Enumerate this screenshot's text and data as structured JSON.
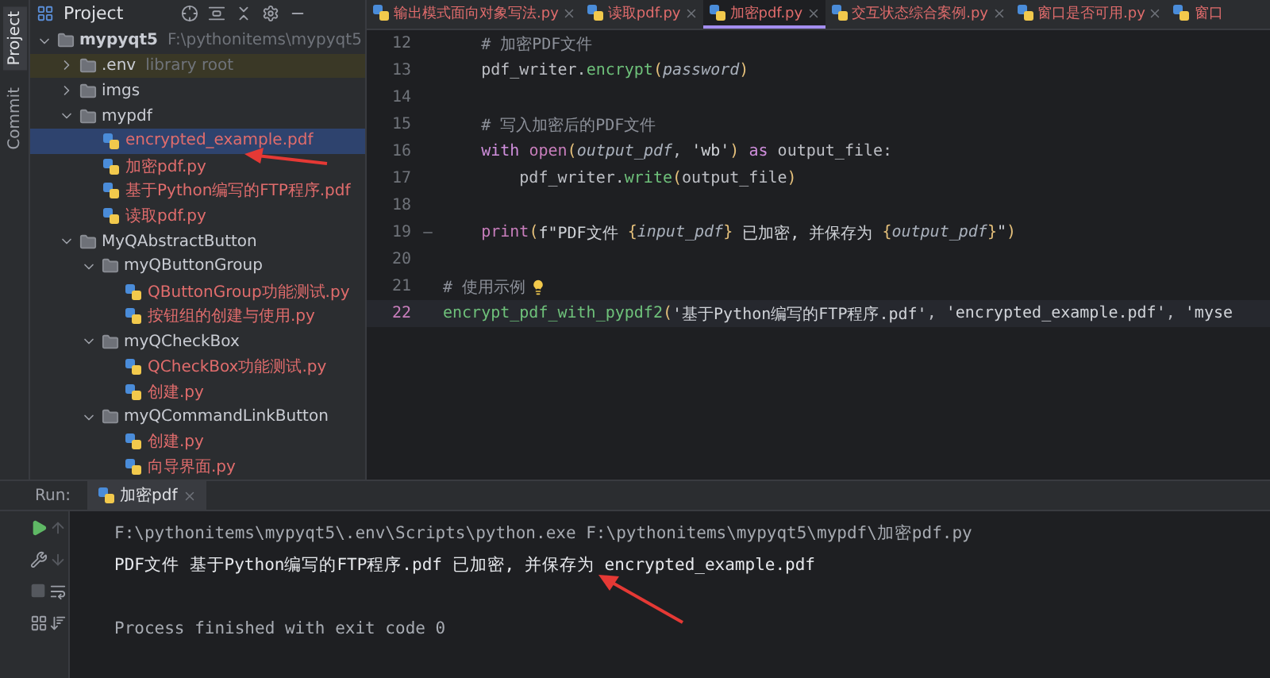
{
  "side_strip": {
    "tabs": [
      {
        "label": "Project",
        "selected": true
      },
      {
        "label": "Commit",
        "selected": false
      }
    ]
  },
  "project_panel": {
    "title": "Project",
    "tree": [
      {
        "kind": "folder",
        "name": "mypyqt5",
        "hint": "F:\\pythonitems\\mypyqt5",
        "expanded": true,
        "selected": false,
        "children": [
          {
            "kind": "library",
            "name": ".env",
            "hint": "library root",
            "expanded": false,
            "selected": false
          },
          {
            "kind": "folder",
            "name": "imgs",
            "expanded": false,
            "selected": false
          },
          {
            "kind": "folder",
            "name": "mypdf",
            "expanded": true,
            "selected": false,
            "children": [
              {
                "kind": "file",
                "name": "encrypted_example.pdf",
                "selected": true
              },
              {
                "kind": "file",
                "name": "加密pdf.py",
                "selected": false
              },
              {
                "kind": "file",
                "name": "基于Python编写的FTP程序.pdf",
                "selected": false
              },
              {
                "kind": "file",
                "name": "读取pdf.py",
                "selected": false
              }
            ]
          },
          {
            "kind": "folder",
            "name": "MyQAbstractButton",
            "expanded": true,
            "selected": false,
            "children": [
              {
                "kind": "folder",
                "name": "myQButtonGroup",
                "expanded": true,
                "selected": false,
                "children": [
                  {
                    "kind": "file",
                    "name": "QButtonGroup功能测试.py",
                    "selected": false
                  },
                  {
                    "kind": "file",
                    "name": "按钮组的创建与使用.py",
                    "selected": false
                  }
                ]
              },
              {
                "kind": "folder",
                "name": "myQCheckBox",
                "expanded": true,
                "selected": false,
                "children": [
                  {
                    "kind": "file",
                    "name": "QCheckBox功能测试.py",
                    "selected": false
                  },
                  {
                    "kind": "file",
                    "name": "创建.py",
                    "selected": false
                  }
                ]
              },
              {
                "kind": "folder",
                "name": "myQCommandLinkButton",
                "expanded": true,
                "selected": false,
                "children": [
                  {
                    "kind": "file",
                    "name": "创建.py",
                    "selected": false
                  },
                  {
                    "kind": "file",
                    "name": "向导界面.py",
                    "selected": false
                  }
                ]
              }
            ]
          }
        ]
      }
    ]
  },
  "editor": {
    "tabs": [
      {
        "label": "输出模式面向对象写法.py",
        "selected": false
      },
      {
        "label": "读取pdf.py",
        "selected": false
      },
      {
        "label": "加密pdf.py",
        "selected": true
      },
      {
        "label": "交互状态综合案例.py",
        "selected": false
      },
      {
        "label": "窗口是否可用.py",
        "selected": false
      },
      {
        "label": "窗口",
        "selected": false
      }
    ],
    "lines": [
      {
        "number": "12",
        "kind": "code",
        "current": false,
        "segments": [
          {
            "kind": "comment",
            "text": "    # 加密PDF文件"
          }
        ]
      },
      {
        "number": "13",
        "kind": "code",
        "current": false,
        "segments": [
          {
            "kind": "plain",
            "text": "    pdf_writer."
          },
          {
            "kind": "fn",
            "text": "encrypt"
          },
          {
            "kind": "paren",
            "text": "("
          },
          {
            "kind": "param",
            "text": "password"
          },
          {
            "kind": "paren",
            "text": ")"
          }
        ]
      },
      {
        "number": "14",
        "kind": "code",
        "current": false
      },
      {
        "number": "15",
        "kind": "code",
        "current": false,
        "segments": [
          {
            "kind": "comment",
            "text": "    # 写入加密后的PDF文件"
          }
        ]
      },
      {
        "number": "16",
        "kind": "code",
        "current": false,
        "segments": [
          {
            "kind": "kw",
            "text": "    with "
          },
          {
            "kind": "builtin",
            "text": "open"
          },
          {
            "kind": "paren",
            "text": "("
          },
          {
            "kind": "param",
            "text": "output_pdf"
          },
          {
            "kind": "plain",
            "text": ", "
          },
          {
            "kind": "string",
            "text": "'wb'"
          },
          {
            "kind": "paren",
            "text": ")"
          },
          {
            "kind": "kw",
            "text": " as "
          },
          {
            "kind": "plain",
            "text": "output_file:"
          }
        ]
      },
      {
        "number": "17",
        "kind": "code",
        "current": false,
        "segments": [
          {
            "kind": "plain",
            "text": "        pdf_writer."
          },
          {
            "kind": "fn",
            "text": "write"
          },
          {
            "kind": "paren",
            "text": "("
          },
          {
            "kind": "plain",
            "text": "output_file"
          },
          {
            "kind": "paren",
            "text": ")"
          }
        ]
      },
      {
        "number": "18",
        "kind": "code",
        "current": false
      },
      {
        "number": "19",
        "kind": "fold",
        "current": false,
        "segments": [
          {
            "kind": "builtin",
            "text": "    print"
          },
          {
            "kind": "paren",
            "text": "("
          },
          {
            "kind": "string",
            "text": "f\"PDF文件 "
          },
          {
            "kind": "brace",
            "text": "{"
          },
          {
            "kind": "param",
            "text": "input_pdf"
          },
          {
            "kind": "brace",
            "text": "}"
          },
          {
            "kind": "string",
            "text": " 已加密, 并保存为 "
          },
          {
            "kind": "brace",
            "text": "{"
          },
          {
            "kind": "param",
            "text": "output_pdf"
          },
          {
            "kind": "brace",
            "text": "}"
          },
          {
            "kind": "string",
            "text": "\""
          },
          {
            "kind": "paren",
            "text": ")"
          }
        ]
      },
      {
        "number": "20",
        "kind": "code",
        "current": false
      },
      {
        "number": "21",
        "kind": "bulb",
        "current": false,
        "segments": [
          {
            "kind": "comment",
            "text": "# 使用示例"
          }
        ]
      },
      {
        "number": "22",
        "kind": "code",
        "current": true,
        "segments": [
          {
            "kind": "fn",
            "text": "encrypt_pdf_with_pypdf2"
          },
          {
            "kind": "paren",
            "text": "("
          },
          {
            "kind": "string",
            "text": "'基于Python编写的FTP程序.pdf'"
          },
          {
            "kind": "plain",
            "text": ", "
          },
          {
            "kind": "string",
            "text": "'encrypted_example.pdf'"
          },
          {
            "kind": "plain",
            "text": ", "
          },
          {
            "kind": "string",
            "text": "'myse"
          }
        ]
      }
    ]
  },
  "run_panel": {
    "label": "Run:",
    "tab": "加密pdf",
    "console": [
      {
        "kind": "command",
        "text": "F:\\pythonitems\\mypyqt5\\.env\\Scripts\\python.exe F:\\pythonitems\\mypyqt5\\mypdf\\加密pdf.py"
      },
      {
        "kind": "output",
        "text": "PDF文件 基于Python编写的FTP程序.pdf 已加密, 并保存为 encrypted_example.pdf"
      },
      {
        "kind": "blank"
      },
      {
        "kind": "exit",
        "text": "Process finished with exit code 0"
      }
    ]
  }
}
